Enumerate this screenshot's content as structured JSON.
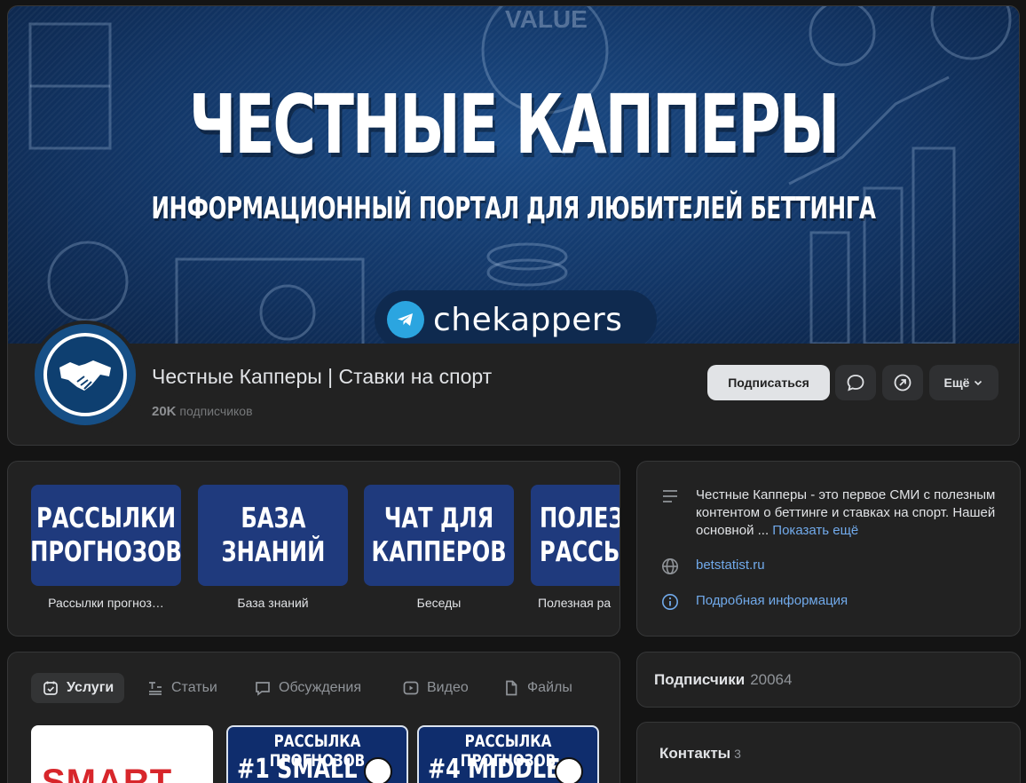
{
  "cover": {
    "title": "ЧЕСТНЫЕ КАППЕРЫ",
    "subtitle": "ИНФОРМАЦИОННЫЙ ПОРТАЛ ДЛЯ ЛЮБИТЕЛЕЙ БЕТТИНГА",
    "telegram_handle": "chekappers",
    "background_text": "VALUE"
  },
  "group": {
    "name": "Честные Капперы | Ставки на спорт",
    "subscribers_short": "20K",
    "subscribers_label": "подписчиков"
  },
  "actions": {
    "subscribe": "Подписаться",
    "more": "Ещё",
    "message_icon": "chat-bubble-icon",
    "share_icon": "share-arrow-icon"
  },
  "links": [
    {
      "thumb": "РАССЫЛКИ\nПРОГНОЗОВ",
      "caption": "Рассылки прогноз…"
    },
    {
      "thumb": "БАЗА\nЗНАНИЙ",
      "caption": "База знаний"
    },
    {
      "thumb": "ЧАТ ДЛЯ\nКАППЕРОВ",
      "caption": "Беседы"
    },
    {
      "thumb": "ПОЛЕЗ\nРАССЫ",
      "caption": "Полезная ра"
    }
  ],
  "tabs": [
    {
      "label": "Услуги",
      "icon": "calendar-check-icon",
      "active": true
    },
    {
      "label": "Статьи",
      "icon": "text-lines-icon",
      "active": false
    },
    {
      "label": "Обсуждения",
      "icon": "speech-bubble-icon",
      "active": false
    },
    {
      "label": "Видео",
      "icon": "play-icon",
      "active": false
    },
    {
      "label": "Файлы",
      "icon": "file-icon",
      "active": false
    }
  ],
  "products": [
    {
      "text": "SMART"
    },
    {
      "line1": "РАССЫЛКА ПРОГНОЗОВ",
      "line2": "#1 SMALL"
    },
    {
      "line1": "РАССЫЛКА ПРОГНОЗОВ",
      "line2": "#4 MIDDLE"
    }
  ],
  "info": {
    "description": "Честные Капперы - это первое СМИ с полезным контентом о беттинге и ставках на спорт. Нашей основной ...",
    "show_more": "Показать ещё",
    "website": "betstatist.ru",
    "details": "Подробная информация"
  },
  "subscribers_block": {
    "title": "Подписчики",
    "count": "20064"
  },
  "contacts_block": {
    "title": "Контакты",
    "count": "3"
  },
  "colors": {
    "accent_link": "#71aaeb",
    "card_bg": "#222222",
    "page_bg": "#141414",
    "cover_blue": "#123565"
  }
}
